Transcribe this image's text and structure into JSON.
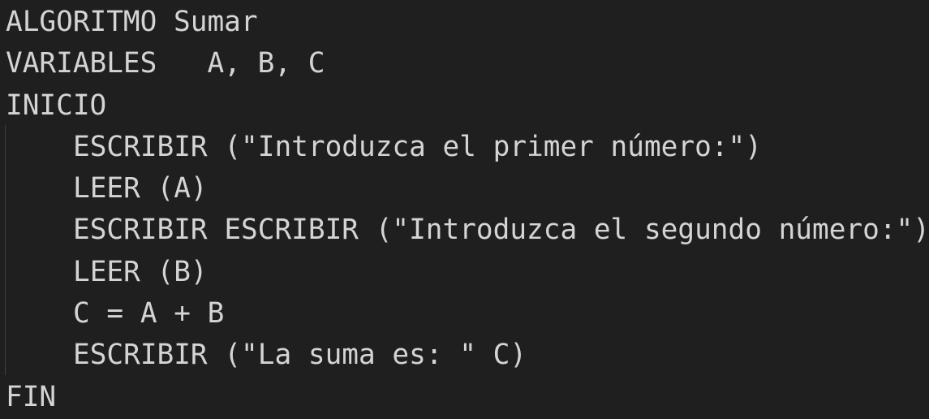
{
  "editor": {
    "lines": [
      "ALGORITMO Sumar",
      "VARIABLES   A, B, C",
      "INICIO",
      "ESCRIBIR (\"Introduzca el primer número:\")",
      "LEER (A)",
      "ESCRIBIR ESCRIBIR (\"Introduzca el segundo número:\")",
      "LEER (B)",
      "C = A + B",
      "ESCRIBIR (\"La suma es: \" C)",
      "FIN"
    ],
    "colors": {
      "background": "#1f1f1f",
      "text": "#d4d4d4",
      "indent_guide": "#404040"
    }
  }
}
